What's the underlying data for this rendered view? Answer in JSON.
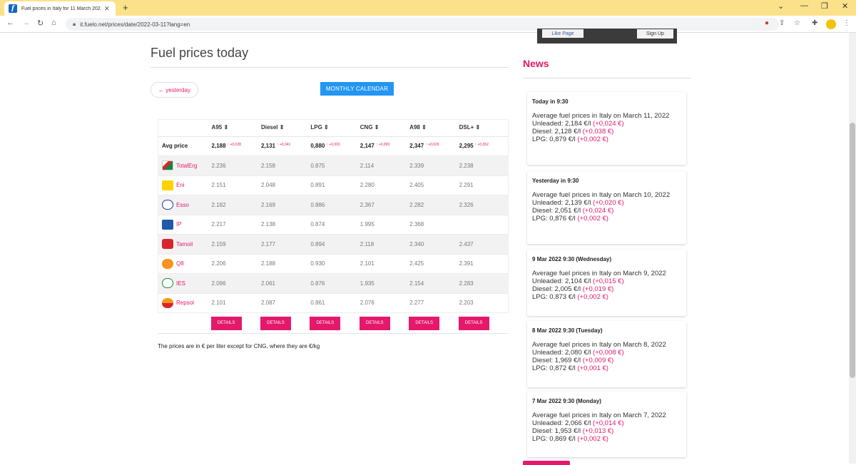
{
  "browser": {
    "tab_title": "Fuel prices in Italy for 11 March 202…",
    "url": "it.fuelo.net/prices/date/2022-03-11?lang=en"
  },
  "page": {
    "title": "Fuel prices today",
    "yesterday_label": "← yesterday",
    "monthly_label": "MONTHLY CALENDAR",
    "footnote": "The prices are in € per liter except for CNG, where they are €/kg"
  },
  "table": {
    "headers": [
      "A95 ⇕",
      "Diesel ⇕",
      "LPG ⇕",
      "CNG ⇕",
      "A98 ⇕",
      "DSL+ ⇕"
    ],
    "avg_label": "Avg price",
    "avg": [
      {
        "value": "2,188",
        "delta": "↑ +0,028"
      },
      {
        "value": "2,131",
        "delta": "↑ +0,041"
      },
      {
        "value": "0,880",
        "delta": "↑ +0,003"
      },
      {
        "value": "2,147",
        "delta": "↑ +0,099"
      },
      {
        "value": "2,347",
        "delta": "↑ +0,029"
      },
      {
        "value": "2,295",
        "delta": "↑ +0,052"
      }
    ],
    "rows": [
      {
        "brand": "TotalErg",
        "values": [
          "2.236",
          "2.158",
          "0.875",
          "2.114",
          "2.339",
          "2.238"
        ]
      },
      {
        "brand": "Eni",
        "values": [
          "2.151",
          "2.048",
          "0.891",
          "2.280",
          "2.405",
          "2.291"
        ]
      },
      {
        "brand": "Esso",
        "values": [
          "2.182",
          "2.169",
          "0.886",
          "2.367",
          "2.282",
          "2.326"
        ]
      },
      {
        "brand": "IP",
        "values": [
          "2.217",
          "2.138",
          "0.874",
          "1.995",
          "2.368",
          ""
        ]
      },
      {
        "brand": "Tamoil",
        "values": [
          "2.159",
          "2.177",
          "0.894",
          "2.118",
          "2.340",
          "2.437"
        ]
      },
      {
        "brand": "Q8",
        "values": [
          "2.206",
          "2.188",
          "0.930",
          "2.101",
          "2.425",
          "2.391"
        ]
      },
      {
        "brand": "IES",
        "values": [
          "2.096",
          "2.061",
          "0.876",
          "1.935",
          "2.154",
          "2.283"
        ]
      },
      {
        "brand": "Repsol",
        "values": [
          "2.101",
          "2.087",
          "0.861",
          "2.076",
          "2.277",
          "2.203"
        ]
      }
    ],
    "details_label": "DETAILS"
  },
  "sidebar": {
    "fb_like": "Like Page",
    "fb_signup": "Sign Up",
    "news_title": "News",
    "news": [
      {
        "date": "Today in 9:30",
        "headline": "Average fuel prices in Italy on March 11, 2022",
        "unleaded": "Unleaded: 2,184 €/l",
        "unleaded_delta": "(+0,024 €)",
        "diesel": "Diesel: 2,128 €/l",
        "diesel_delta": "(+0,038 €)",
        "lpg": "LPG: 0,879 €/l",
        "lpg_delta": "(+0,002 €)"
      },
      {
        "date": "Yesterday in 9:30",
        "headline": "Average fuel prices in Italy on March 10, 2022",
        "unleaded": "Unleaded: 2,139 €/l",
        "unleaded_delta": "(+0,020 €)",
        "diesel": "Diesel: 2,051 €/l",
        "diesel_delta": "(+0,024 €)",
        "lpg": "LPG: 0,876 €/l",
        "lpg_delta": "(+0,002 €)"
      },
      {
        "date": "9 Mar 2022 9:30 (Wednesday)",
        "headline": "Average fuel prices in Italy on March 9, 2022",
        "unleaded": "Unleaded: 2,104 €/l",
        "unleaded_delta": "(+0,015 €)",
        "diesel": "Diesel: 2,005 €/l",
        "diesel_delta": "(+0,019 €)",
        "lpg": "LPG: 0,873 €/l",
        "lpg_delta": "(+0,002 €)"
      },
      {
        "date": "8 Mar 2022 9:30 (Tuesday)",
        "headline": "Average fuel prices in Italy on March 8, 2022",
        "unleaded": "Unleaded: 2,080 €/l",
        "unleaded_delta": "(+0,008 €)",
        "diesel": "Diesel: 1,969 €/l",
        "diesel_delta": "(+0,009 €)",
        "lpg": "LPG: 0,872 €/l",
        "lpg_delta": "(+0,001 €)"
      },
      {
        "date": "7 Mar 2022 9:30 (Monday)",
        "headline": "Average fuel prices in Italy on March 7, 2022",
        "unleaded": "Unleaded: 2,066 €/l",
        "unleaded_delta": "(+0,014 €)",
        "diesel": "Diesel: 1,953 €/l",
        "diesel_delta": "(+0,013 €)",
        "lpg": "LPG: 0,869 €/l",
        "lpg_delta": "(+0,002 €)"
      }
    ]
  },
  "colors": {
    "accent": "#e5196c",
    "button_blue": "#2196f3",
    "tabbar": "#fbe28a"
  }
}
